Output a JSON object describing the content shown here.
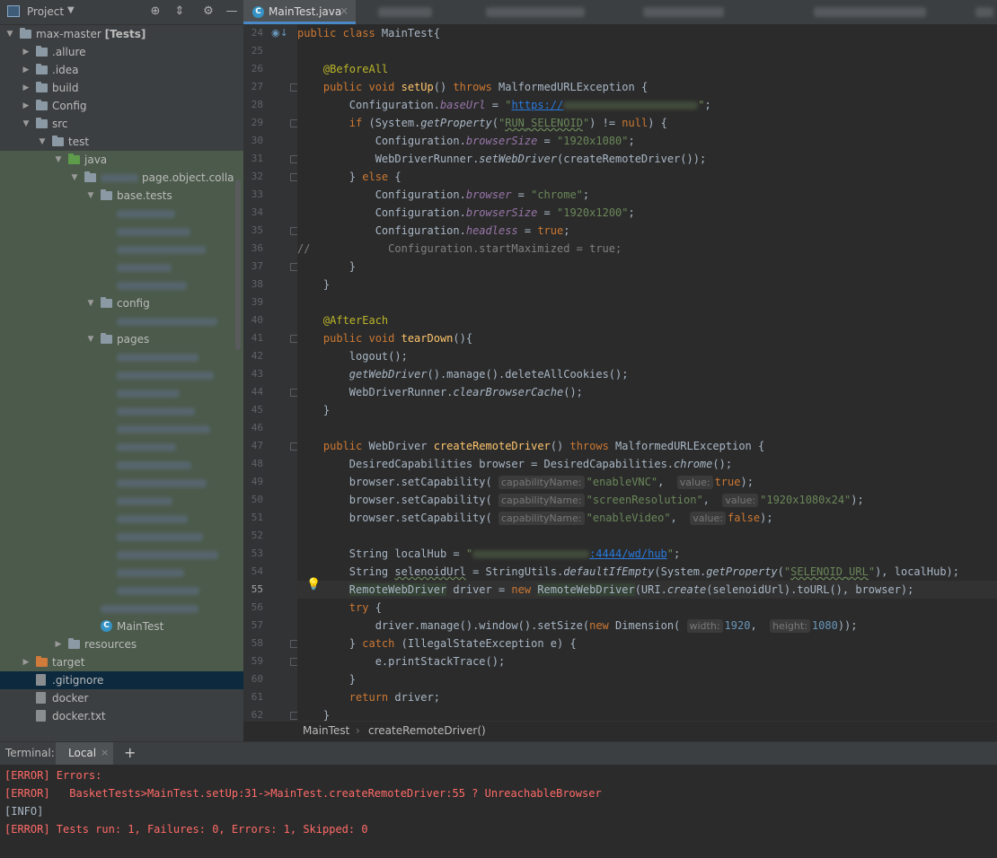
{
  "sidebar": {
    "title": "Project",
    "tree": [
      {
        "label": "max-master [Tests]",
        "depth": 0,
        "arrow": "down",
        "icon": "folder"
      },
      {
        "label": ".allure",
        "depth": 1,
        "arrow": "right",
        "icon": "folder"
      },
      {
        "label": ".idea",
        "depth": 1,
        "arrow": "right",
        "icon": "folder"
      },
      {
        "label": "build",
        "depth": 1,
        "arrow": "right",
        "icon": "folder"
      },
      {
        "label": "Config",
        "depth": 1,
        "arrow": "right",
        "icon": "folder"
      },
      {
        "label": "src",
        "depth": 1,
        "arrow": "down",
        "icon": "folder"
      },
      {
        "label": "test",
        "depth": 2,
        "arrow": "down",
        "icon": "folder"
      },
      {
        "label": "java",
        "depth": 3,
        "arrow": "down",
        "icon": "folder-green"
      },
      {
        "label": "page.object.colla",
        "depth": 4,
        "arrow": "down",
        "icon": "package"
      },
      {
        "label": "base.tests",
        "depth": 5,
        "arrow": "down",
        "icon": "package"
      },
      {
        "label": "",
        "depth": 6,
        "arrow": "",
        "icon": "blur"
      },
      {
        "label": "",
        "depth": 6,
        "arrow": "",
        "icon": "blur"
      },
      {
        "label": "",
        "depth": 6,
        "arrow": "",
        "icon": "blur"
      },
      {
        "label": "",
        "depth": 6,
        "arrow": "",
        "icon": "blur"
      },
      {
        "label": "",
        "depth": 6,
        "arrow": "",
        "icon": "blur"
      },
      {
        "label": "config",
        "depth": 5,
        "arrow": "down",
        "icon": "package"
      },
      {
        "label": "",
        "depth": 6,
        "arrow": "",
        "icon": "blur"
      },
      {
        "label": "pages",
        "depth": 5,
        "arrow": "down",
        "icon": "package"
      },
      {
        "label": "",
        "depth": 6,
        "arrow": "",
        "icon": "blur"
      },
      {
        "label": "",
        "depth": 6,
        "arrow": "",
        "icon": "blur"
      },
      {
        "label": "",
        "depth": 6,
        "arrow": "",
        "icon": "blur"
      },
      {
        "label": "",
        "depth": 6,
        "arrow": "",
        "icon": "blur"
      },
      {
        "label": "",
        "depth": 6,
        "arrow": "",
        "icon": "blur"
      },
      {
        "label": "",
        "depth": 6,
        "arrow": "",
        "icon": "blur"
      },
      {
        "label": "",
        "depth": 6,
        "arrow": "",
        "icon": "blur"
      },
      {
        "label": "",
        "depth": 6,
        "arrow": "",
        "icon": "blur"
      },
      {
        "label": "",
        "depth": 6,
        "arrow": "",
        "icon": "blur"
      },
      {
        "label": "",
        "depth": 6,
        "arrow": "",
        "icon": "blur"
      },
      {
        "label": "",
        "depth": 6,
        "arrow": "",
        "icon": "blur"
      },
      {
        "label": "",
        "depth": 6,
        "arrow": "",
        "icon": "blur"
      },
      {
        "label": "",
        "depth": 6,
        "arrow": "",
        "icon": "blur"
      },
      {
        "label": "",
        "depth": 6,
        "arrow": "",
        "icon": "blur"
      },
      {
        "label": "",
        "depth": 5,
        "arrow": "",
        "icon": "blur"
      },
      {
        "label": "MainTest",
        "depth": 5,
        "arrow": "",
        "icon": "class"
      },
      {
        "label": "resources",
        "depth": 3,
        "arrow": "right",
        "icon": "folder"
      },
      {
        "label": "target",
        "depth": 1,
        "arrow": "right",
        "icon": "folder-orange"
      },
      {
        "label": ".gitignore",
        "depth": 1,
        "arrow": "",
        "icon": "file"
      },
      {
        "label": "docker",
        "depth": 1,
        "arrow": "",
        "icon": "file"
      },
      {
        "label": "docker.txt",
        "depth": 1,
        "arrow": "",
        "icon": "file"
      }
    ]
  },
  "editor": {
    "active_tab": "MainTest.java",
    "first_line": 24,
    "current_line": 55,
    "lines": [
      "<span class=\"k\">public class </span>MainTest{",
      "",
      "    <span class=\"an\">@BeforeAll</span>",
      "    <span class=\"k\">public void </span><span class=\"fn\">setUp</span>() <span class=\"k\">throws </span>MalformedURLException {",
      "        Configuration.<span class=\"fld\">baseUrl</span> = <span class=\"s\">\"<span class=\"url\">https://</span><span class=\"blurtxt\"></span>\"</span>;",
      "        <span class=\"k\">if </span>(System.<span class=\"it\">getProperty</span>(<span class=\"s\">\"<span class=\"sq\">RUN_SELENOID</span>\"</span>) != <span class=\"k\">null</span>) {",
      "            Configuration.<span class=\"fld\">browserSize</span> = <span class=\"s\">\"1920x1080\"</span>;",
      "            WebDriverRunner.<span class=\"it\">setWebDriver</span>(createRemoteDriver());",
      "        } <span class=\"k\">else </span>{",
      "            Configuration.<span class=\"fld\">browser</span> = <span class=\"s\">\"chrome\"</span>;",
      "            Configuration.<span class=\"fld\">browserSize</span> = <span class=\"s\">\"1920x1200\"</span>;",
      "            Configuration.<span class=\"fld\">headless</span> = <span class=\"k\">true</span>;",
      "<span class=\"cm\">//            Configuration.startMaximized = true;</span>",
      "        }",
      "    }",
      "",
      "    <span class=\"an\">@AfterEach</span>",
      "    <span class=\"k\">public void </span><span class=\"fn\">tearDown</span>(){",
      "        logout();",
      "        <span class=\"it\">getWebDriver</span>().manage().deleteAllCookies();",
      "        WebDriverRunner.<span class=\"it\">clearBrowserCache</span>();",
      "    }",
      "",
      "    <span class=\"k\">public </span>WebDriver <span class=\"fn\">createRemoteDriver</span>() <span class=\"k\">throws </span>MalformedURLException {",
      "        DesiredCapabilities browser = DesiredCapabilities.<span class=\"it\">chrome</span>();",
      "        browser.setCapability( <span class=\"hint\">capabilityName:</span><span class=\"s\">\"enableVNC\"</span>,  <span class=\"hint\">value:</span><span class=\"k\">true</span>);",
      "        browser.setCapability( <span class=\"hint\">capabilityName:</span><span class=\"s\">\"screenResolution\"</span>,  <span class=\"hint\">value:</span><span class=\"s\">\"1920x1080x24\"</span>);",
      "        browser.setCapability( <span class=\"hint\">capabilityName:</span><span class=\"s\">\"enableVideo\"</span>,  <span class=\"hint\">value:</span><span class=\"k\">false</span>);",
      "",
      "        String localHub = <span class=\"s\">\"<span class=\"blurtxt\" style=\"width:130px\"></span><span class=\"url\">:4444/wd/hub</span>\"</span>;",
      "        String <span class=\"sq\">selenoidUrl</span> = StringUtils.<span class=\"it\">defaultIfEmpty</span>(System.<span class=\"it\">getProperty</span>(<span class=\"s\">\"<span class=\"sq\">SELENOID_URL</span>\"</span>), localHub);",
      "        <span class=\"ref\">RemoteWebDriver</span> driver = <span class=\"k\">new </span><span class=\"ref\">RemoteWebDriver</span>(URI.<span class=\"it\">create</span>(selenoidUrl).toURL(), browser);",
      "        <span class=\"k\">try </span>{",
      "            driver.manage().window().setSize(<span class=\"k\">new </span>Dimension( <span class=\"hint\">width:</span><span class=\"n\">1920</span>,  <span class=\"hint\">height:</span><span class=\"n\">1080</span>));",
      "        } <span class=\"k\">catch </span>(IllegalStateException e) {",
      "            e.printStackTrace();",
      "        }",
      "        <span class=\"k\">return </span>driver;",
      "    }"
    ]
  },
  "breadcrumb": {
    "class": "MainTest",
    "method": "createRemoteDriver()"
  },
  "terminal": {
    "title": "Terminal:",
    "tab": "Local",
    "lines": [
      {
        "text": "[ERROR] Errors:",
        "type": "err"
      },
      {
        "text": "[ERROR]   BasketTests>MainTest.setUp:31->MainTest.createRemoteDriver:55 ? UnreachableBrowser",
        "type": "err"
      },
      {
        "text": "[INFO]",
        "type": "info"
      },
      {
        "text": "[ERROR] Tests run: 1, Failures: 0, Errors: 1, Skipped: 0",
        "type": "err"
      }
    ]
  }
}
